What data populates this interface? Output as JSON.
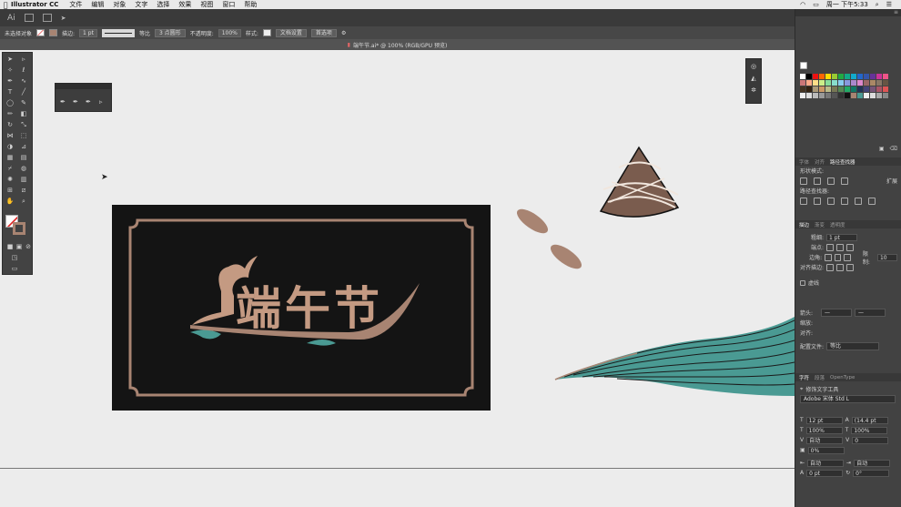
{
  "menubar": {
    "app_name": "Illustrator CC",
    "items": [
      "文件",
      "编辑",
      "对象",
      "文字",
      "选择",
      "效果",
      "视图",
      "窗口",
      "帮助"
    ],
    "clock": "周一 下午5:33"
  },
  "appbar": {
    "logo": "Ai"
  },
  "control_bar": {
    "selection": "未选择对象",
    "stroke_label": "描边:",
    "stroke_value": "1 pt",
    "line_style": "等比",
    "brush": "3 点圆形",
    "opacity_label": "不透明度:",
    "opacity_value": "100%",
    "style_label": "样式:",
    "doc_setup": "文档设置",
    "prefs": "首选项"
  },
  "document_tab": {
    "title": "端午节.ai* @ 100% (RGB/GPU 预览)"
  },
  "artwork": {
    "title_text": "端午节"
  },
  "right_panel": {
    "top_tabs": [
      "字体",
      "对齐",
      "路径查找器"
    ],
    "shape_modes_label": "形状模式:",
    "expand_btn": "扩展",
    "pathfinder_label": "路径查找器:",
    "stroke_tabs": [
      "描边",
      "渐变",
      "透明度"
    ],
    "weight_label": "粗细:",
    "weight_value": "1 pt",
    "cap_label": "端点:",
    "corner_label": "边角:",
    "limit_label": "限制:",
    "limit_value": "10",
    "align_stroke_label": "对齐描边:",
    "dashed_label": "虚线",
    "arrow_label": "箭头:",
    "scale_label": "缩放:",
    "align_label": "对齐:",
    "profile_label": "配置文件:",
    "profile_value": "等比",
    "char_tabs": [
      "字符",
      "段落",
      "OpenType"
    ],
    "touch_type": "修饰文字工具",
    "font_name": "Adobe 宋体 Std L",
    "font_size": "12 pt",
    "leading": "(14.4 pt",
    "h_scale": "100%",
    "v_scale": "100%",
    "kerning": "自动",
    "tracking": "0",
    "rotate": "0%",
    "auto1": "自动",
    "auto2": "自动",
    "baseline": "0 pt",
    "char_rot": "0°"
  },
  "colors": {
    "ui_dark": "#3a3a3a",
    "panel": "#424242",
    "canvas": "#ececec",
    "art_bg": "#141414",
    "tan": "#a88472",
    "teal": "#4a9a93"
  }
}
